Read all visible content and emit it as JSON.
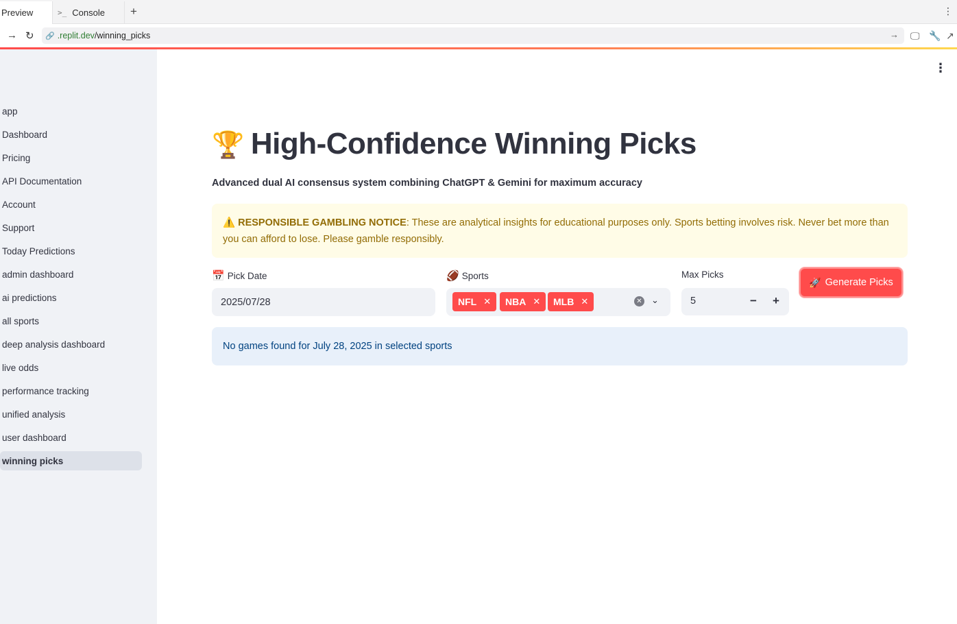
{
  "browser": {
    "tabs": [
      {
        "label": "Preview"
      },
      {
        "label": "Console"
      }
    ],
    "url_host": ".replit.dev",
    "url_path": "/winning_picks"
  },
  "sidebar": {
    "items": [
      {
        "label": "app"
      },
      {
        "label": "Dashboard"
      },
      {
        "label": "Pricing"
      },
      {
        "label": "API Documentation"
      },
      {
        "label": "Account"
      },
      {
        "label": "Support"
      },
      {
        "label": "Today Predictions"
      },
      {
        "label": "admin dashboard"
      },
      {
        "label": "ai predictions"
      },
      {
        "label": "all sports"
      },
      {
        "label": "deep analysis dashboard"
      },
      {
        "label": "live odds"
      },
      {
        "label": "performance tracking"
      },
      {
        "label": "unified analysis"
      },
      {
        "label": "user dashboard"
      },
      {
        "label": "winning picks"
      }
    ],
    "active_item": "winning picks"
  },
  "main": {
    "title": "High-Confidence Winning Picks",
    "title_icon": "trophy-icon",
    "subtitle": "Advanced dual AI consensus system combining ChatGPT & Gemini for maximum accuracy",
    "notice": {
      "heading": "RESPONSIBLE GAMBLING NOTICE",
      "body": ": These are analytical insights for educational purposes only. Sports betting involves risk. Never bet more than you can afford to lose. Please gamble responsibly."
    },
    "pick_date": {
      "label": "Pick Date",
      "value": "2025/07/28"
    },
    "sports": {
      "label": "Sports",
      "selected": [
        "NFL",
        "NBA",
        "MLB"
      ]
    },
    "max_picks": {
      "label": "Max Picks",
      "value": "5"
    },
    "generate_button": "Generate Picks",
    "info_message": "No games found for July 28, 2025 in selected sports"
  },
  "colors": {
    "accent": "#ff4b4b",
    "sidebar_bg": "#f0f2f6",
    "notice_bg": "#fffce7",
    "notice_text": "#926c05",
    "info_bg": "#e8f0fa",
    "info_text": "#004280"
  }
}
